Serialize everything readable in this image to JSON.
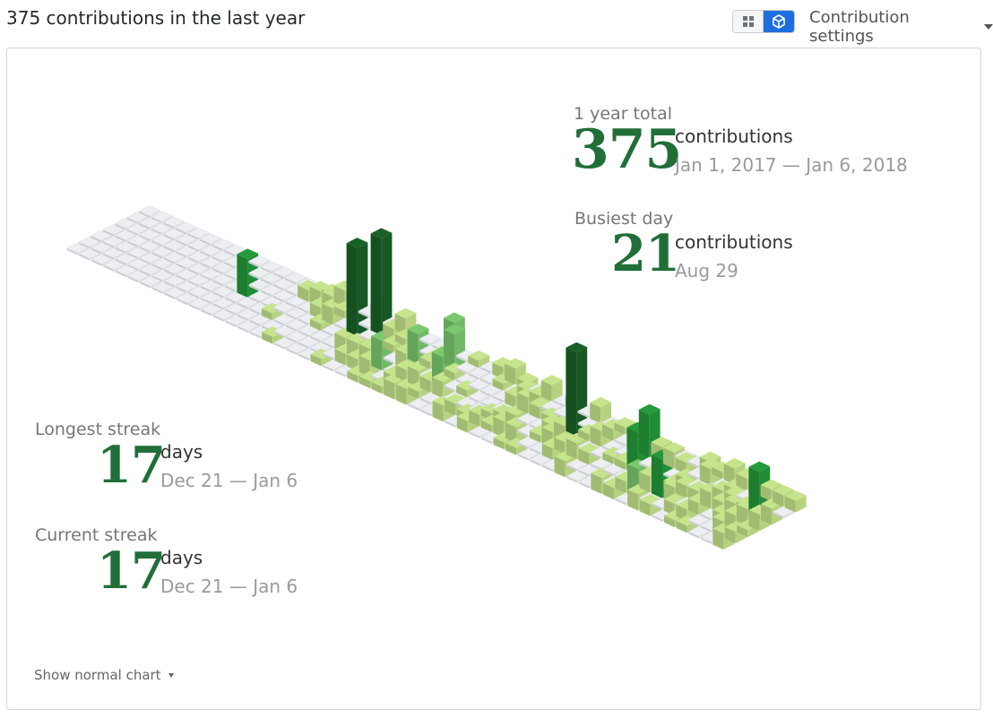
{
  "header": {
    "title": "375 contributions in the last year",
    "settings_label": "Contribution settings"
  },
  "view_toggle": {
    "options": [
      {
        "icon": "grid-icon",
        "active": false
      },
      {
        "icon": "cube-icon",
        "active": true
      }
    ]
  },
  "stats": {
    "total": {
      "label": "1 year total",
      "value": "375",
      "unit": "contributions",
      "range": "Jan 1, 2017 — Jan 6, 2018"
    },
    "busiest": {
      "label": "Busiest day",
      "value": "21",
      "unit": "contributions",
      "range": "Aug 29"
    },
    "longest": {
      "label": "Longest streak",
      "value": "17",
      "unit": "days",
      "range": "Dec 21 — Jan 6"
    },
    "current": {
      "label": "Current streak",
      "value": "17",
      "unit": "days",
      "range": "Dec 21 — Jan 6"
    }
  },
  "footer": {
    "show_normal_label": "Show normal chart"
  },
  "colors": {
    "empty": "#ebedf0",
    "level1": "#c6e48b",
    "level2": "#7bc96f",
    "level3": "#239a3b",
    "level4": "#196127",
    "accent": "#1e6fde",
    "stat_number": "#216e39"
  },
  "chart_data": {
    "type": "heatmap",
    "weeks": 54,
    "days_per_week": 7,
    "tall_bars": [
      {
        "week": 19,
        "day": 2,
        "value": 19
      },
      {
        "week": 20,
        "day": 1,
        "value": 21
      },
      {
        "week": 11,
        "day": 3,
        "value": 8
      },
      {
        "week": 25,
        "day": 0,
        "value": 7
      },
      {
        "week": 26,
        "day": 1,
        "value": 7
      },
      {
        "week": 37,
        "day": 2,
        "value": 18
      },
      {
        "week": 42,
        "day": 1,
        "value": 9
      },
      {
        "week": 43,
        "day": 3,
        "value": 9
      },
      {
        "week": 46,
        "day": 4,
        "value": 8
      },
      {
        "week": 52,
        "day": 2,
        "value": 10
      },
      {
        "week": 24,
        "day": 2,
        "value": 6
      },
      {
        "week": 27,
        "day": 3,
        "value": 6
      },
      {
        "week": 23,
        "day": 4,
        "value": 6
      },
      {
        "week": 45,
        "day": 5,
        "value": 6
      }
    ]
  }
}
